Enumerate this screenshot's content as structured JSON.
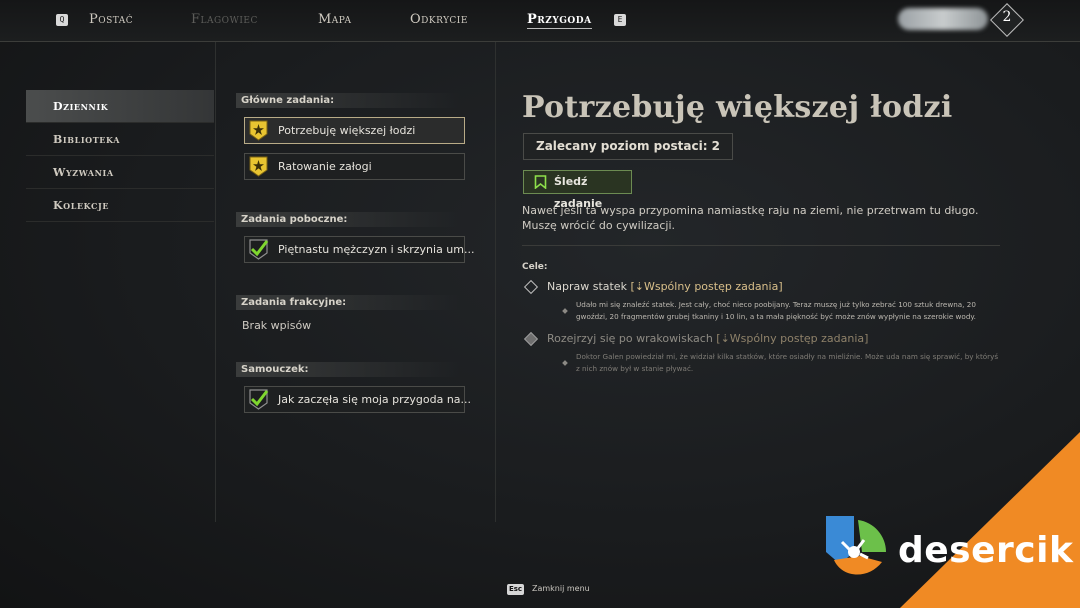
{
  "topnav": {
    "left_key": "Q",
    "right_key": "E",
    "tabs": [
      {
        "label": "Postać",
        "state": "normal"
      },
      {
        "label": "Flagowiec",
        "state": "disabled"
      },
      {
        "label": "Mapa",
        "state": "normal"
      },
      {
        "label": "Odkrycie",
        "state": "normal"
      },
      {
        "label": "Przygoda",
        "state": "active"
      }
    ],
    "player_level": "2"
  },
  "sidebar": {
    "items": [
      {
        "label": "Dziennik",
        "active": true
      },
      {
        "label": "Biblioteka",
        "active": false
      },
      {
        "label": "Wyzwania",
        "active": false
      },
      {
        "label": "Kolekcje",
        "active": false
      }
    ]
  },
  "quests": {
    "main": {
      "label": "Główne zadania:",
      "items": [
        {
          "title": "Potrzebuję większej łodzi",
          "icon": "gold-star-badge-icon",
          "selected": true
        },
        {
          "title": "Ratowanie załogi",
          "icon": "gold-star-badge-icon",
          "selected": false
        }
      ]
    },
    "side": {
      "label": "Zadania poboczne:",
      "items": [
        {
          "title": "Piętnastu mężczyzn i skrzynia um...",
          "icon": "completed-check-icon"
        }
      ]
    },
    "faction": {
      "label": "Zadania frakcyjne:",
      "empty_text": "Brak wpisów"
    },
    "tutorial": {
      "label": "Samouczek:",
      "items": [
        {
          "title": "Jak zaczęła się moja przygoda na...",
          "icon": "completed-check-icon"
        }
      ]
    }
  },
  "detail": {
    "title": "Potrzebuję większej łodzi",
    "recommended_level": "Zalecany poziom postaci: 2",
    "track_button": "Śledź zadanie",
    "description": "Nawet jeśli ta wyspa przypomina namiastkę raju na ziemi, nie przetrwam tu długo. Muszę wrócić do cywilizacji.",
    "objectives_label": "Cele:",
    "objectives": [
      {
        "title": "Napraw statek",
        "tag": "[⇣Wspólny postęp zadania]",
        "description": "Udało mi się znaleźć statek. Jest cały, choć nieco poobijany. Teraz muszę już tylko zebrać 100 sztuk drewna, 20 gwoździ, 20 fragmentów grubej tkaniny i 10 lin, a ta mała piękność być może znów wypłynie na szerokie wody.",
        "active": true
      },
      {
        "title": "Rozejrzyj się po wrakowiskach",
        "tag": "[⇣Wspólny postęp zadania]",
        "description": "Doktor Galen powiedział mi, że widział kilka statków, które osiadły na mieliźnie. Może uda nam się sprawić, by któryś z nich znów był w stanie pływać.",
        "active": false
      }
    ]
  },
  "footer": {
    "key": "Esc",
    "label": "Zamknij menu"
  },
  "watermark": {
    "text": "desercik",
    "color": "#f08a24"
  }
}
